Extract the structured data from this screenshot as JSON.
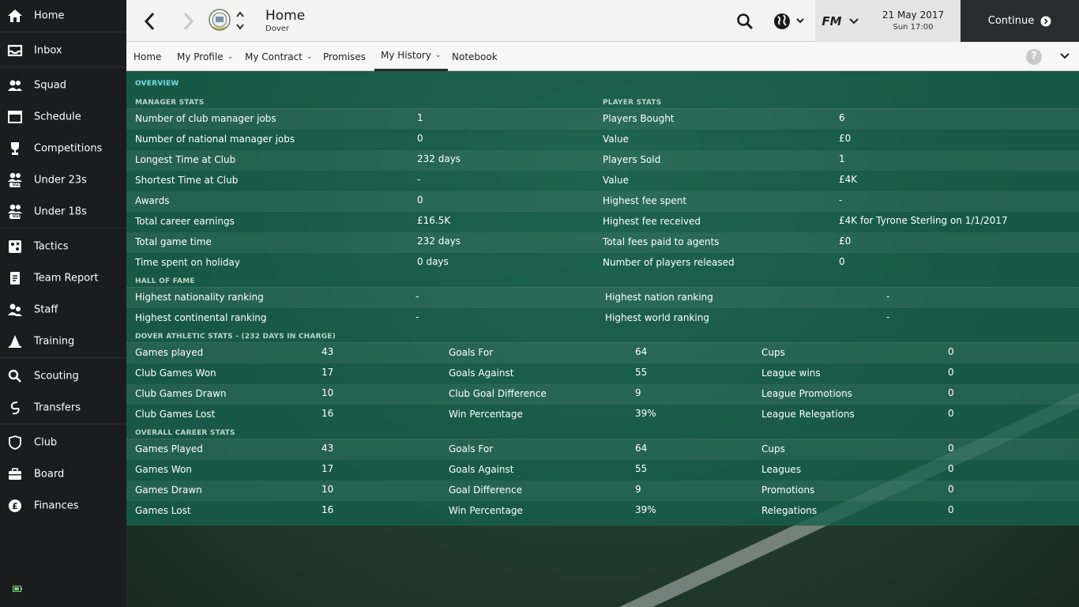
{
  "sidebar": {
    "items": [
      {
        "label": "Home",
        "icon": "home-icon"
      },
      {
        "label": "Inbox",
        "icon": "inbox-icon"
      },
      {
        "label": "Squad",
        "icon": "squad-icon"
      },
      {
        "label": "Schedule",
        "icon": "calendar-icon"
      },
      {
        "label": "Competitions",
        "icon": "trophy-icon"
      },
      {
        "label": "Under 23s",
        "icon": "under23-icon"
      },
      {
        "label": "Under 18s",
        "icon": "under18-icon"
      },
      {
        "label": "Tactics",
        "icon": "tactics-icon"
      },
      {
        "label": "Team Report",
        "icon": "report-icon"
      },
      {
        "label": "Staff",
        "icon": "staff-icon"
      },
      {
        "label": "Training",
        "icon": "training-cone-icon"
      },
      {
        "label": "Scouting",
        "icon": "search-icon"
      },
      {
        "label": "Transfers",
        "icon": "transfers-icon"
      },
      {
        "label": "Club",
        "icon": "shield-icon"
      },
      {
        "label": "Board",
        "icon": "briefcase-icon"
      },
      {
        "label": "Finances",
        "icon": "pound-coin-icon"
      }
    ],
    "under23_badge": "U23",
    "under18_badge": "U18"
  },
  "header": {
    "title": "Home",
    "subtitle": "Dover",
    "fm_label": "FM",
    "date": "21 May 2017",
    "time": "Sun 17:00",
    "continue_label": "Continue"
  },
  "tabs": [
    {
      "label": "Home",
      "dropdown": false,
      "active": false
    },
    {
      "label": "My Profile",
      "dropdown": true,
      "active": false
    },
    {
      "label": "My Contract",
      "dropdown": true,
      "active": false
    },
    {
      "label": "Promises",
      "dropdown": false,
      "active": false
    },
    {
      "label": "My History",
      "dropdown": true,
      "active": true
    },
    {
      "label": "Notebook",
      "dropdown": false,
      "active": false
    }
  ],
  "help_label": "?",
  "overview": {
    "heading": "OVERVIEW",
    "manager_stats": {
      "heading": "MANAGER STATS",
      "rows": [
        {
          "label": "Number of club manager jobs",
          "value": "1"
        },
        {
          "label": "Number of national manager jobs",
          "value": "0"
        },
        {
          "label": "Longest Time at Club",
          "value": "232 days"
        },
        {
          "label": "Shortest Time at Club",
          "value": "-"
        },
        {
          "label": "Awards",
          "value": "0"
        },
        {
          "label": "Total career earnings",
          "value": "£16.5K"
        },
        {
          "label": "Total game time",
          "value": "232 days"
        },
        {
          "label": "Time spent on holiday",
          "value": "0 days"
        }
      ]
    },
    "player_stats": {
      "heading": "PLAYER STATS",
      "rows": [
        {
          "label": "Players Bought",
          "value": "6"
        },
        {
          "label": "Value",
          "value": "£0"
        },
        {
          "label": "Players Sold",
          "value": "1"
        },
        {
          "label": "Value",
          "value": "£4K"
        },
        {
          "label": "Highest fee spent",
          "value": "-"
        },
        {
          "label": "Highest fee received",
          "value": "£4K for Tyrone Sterling on 1/1/2017"
        },
        {
          "label": "Total fees paid to agents",
          "value": "£0"
        },
        {
          "label": "Number of players released",
          "value": "0"
        }
      ]
    },
    "hall_of_fame": {
      "heading": "HALL OF FAME",
      "rows": [
        {
          "label": "Highest nationality ranking",
          "value": "-",
          "label2": "Highest nation ranking",
          "value2": "-"
        },
        {
          "label": "Highest continental ranking",
          "value": "-",
          "label2": "Highest world ranking",
          "value2": "-"
        }
      ]
    },
    "club_stats": {
      "heading": "DOVER ATHLETIC STATS - (232 DAYS IN CHARGE)",
      "rows": [
        [
          "Games played",
          "43",
          "Goals For",
          "64",
          "Cups",
          "0"
        ],
        [
          "Club Games Won",
          "17",
          "Goals Against",
          "55",
          "League wins",
          "0"
        ],
        [
          "Club Games Drawn",
          "10",
          "Club Goal Difference",
          "9",
          "League Promotions",
          "0"
        ],
        [
          "Club Games Lost",
          "16",
          "Win Percentage",
          "39%",
          "League Relegations",
          "0"
        ]
      ]
    },
    "career_stats": {
      "heading": "OVERALL CAREER STATS",
      "rows": [
        [
          "Games Played",
          "43",
          "Goals For",
          "64",
          "Cups",
          "0"
        ],
        [
          "Games Won",
          "17",
          "Goals Against",
          "55",
          "Leagues",
          "0"
        ],
        [
          "Games Drawn",
          "10",
          "Goal Difference",
          "9",
          "Promotions",
          "0"
        ],
        [
          "Games Lost",
          "16",
          "Win Percentage",
          "39%",
          "Relegations",
          "0"
        ]
      ]
    }
  }
}
